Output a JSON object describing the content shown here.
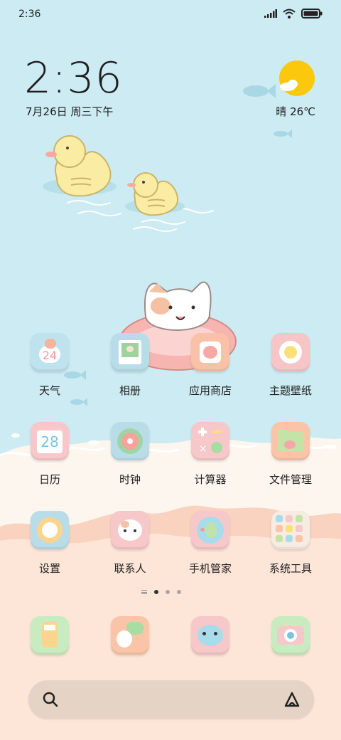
{
  "status_bar": {
    "time": "2:36"
  },
  "lock": {
    "time": "2:36",
    "date": "7月26日 周三下午",
    "weather": "晴 26℃"
  },
  "colors": {
    "sky": "#cdebf3",
    "sand_light": "#fdf3e8",
    "sand": "#fde3d3",
    "wave": "#f6c8b2"
  },
  "apps": [
    {
      "label": "天气",
      "icon": "weather-icon",
      "badge": "24"
    },
    {
      "label": "相册",
      "icon": "gallery-icon"
    },
    {
      "label": "应用商店",
      "icon": "app-store-icon"
    },
    {
      "label": "主题壁纸",
      "icon": "themes-icon"
    },
    {
      "label": "日历",
      "icon": "calendar-icon",
      "badge": "28"
    },
    {
      "label": "时钟",
      "icon": "clock-icon"
    },
    {
      "label": "计算器",
      "icon": "calculator-icon"
    },
    {
      "label": "文件管理",
      "icon": "file-manager-icon"
    },
    {
      "label": "设置",
      "icon": "settings-icon"
    },
    {
      "label": "联系人",
      "icon": "contacts-icon"
    },
    {
      "label": "手机管家",
      "icon": "security-icon"
    },
    {
      "label": "系统工具",
      "icon": "system-tools-icon"
    }
  ],
  "page_indicator": {
    "pages": 3,
    "active": 1
  },
  "dock": [
    {
      "icon": "phone-icon"
    },
    {
      "icon": "messages-icon"
    },
    {
      "icon": "browser-icon"
    },
    {
      "icon": "camera-icon"
    }
  ]
}
